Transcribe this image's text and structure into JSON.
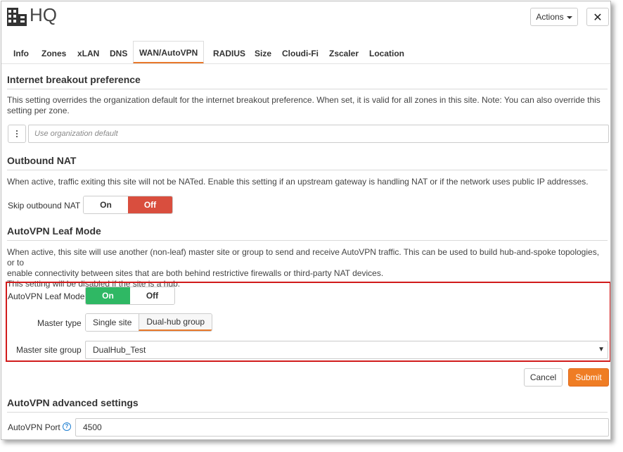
{
  "header": {
    "title": "HQ",
    "actions_label": "Actions",
    "close_label": "✕"
  },
  "tabs": [
    {
      "label": "Info"
    },
    {
      "label": "Zones"
    },
    {
      "label": "xLAN"
    },
    {
      "label": "DNS"
    },
    {
      "label": "WAN/AutoVPN",
      "active": true
    },
    {
      "label": "RADIUS"
    },
    {
      "label": "Size"
    },
    {
      "label": "Cloudi-Fi"
    },
    {
      "label": "Zscaler"
    },
    {
      "label": "Location"
    }
  ],
  "breakout": {
    "title": "Internet breakout preference",
    "description": "This setting overrides the organization default for the internet breakout preference. When set, it is valid for all zones in this site. Note: You can also override this setting per zone.",
    "description_line1": "This setting overrides the organization default for the internet breakout preference. When set, it is valid for all zones in this site. Note: You can also override this",
    "description_line2": "setting per zone.",
    "placeholder": "Use organization default"
  },
  "nat": {
    "title": "Outbound NAT",
    "description": "When active, traffic exiting this site will not be NATed. Enable this setting if an upstream gateway is handling NAT or if the network uses public IP addresses.",
    "skip_label": "Skip outbound NAT",
    "on_label": "On",
    "off_label": "Off",
    "state": "Off"
  },
  "leaf": {
    "title": "AutoVPN Leaf Mode",
    "description_line1": "When active, this site will use another (non-leaf) master site or group to send and receive AutoVPN traffic. This can be used to build hub-and-spoke topologies, or to",
    "description_line2": "enable connectivity between sites that are both behind restrictive firewalls or third-party NAT devices.",
    "description_line3": "This setting will be disabled if the site is a hub.",
    "mode_label": "AutoVPN Leaf Mode",
    "on_label": "On",
    "off_label": "Off",
    "state": "On",
    "master_type_label": "Master type",
    "master_type_options": [
      "Single site",
      "Dual-hub group"
    ],
    "master_type_selected": "Dual-hub group",
    "master_group_label": "Master site group",
    "master_group_value": "DualHub_Test"
  },
  "form": {
    "cancel_label": "Cancel",
    "submit_label": "Submit"
  },
  "advanced": {
    "title": "AutoVPN advanced settings",
    "port_label": "AutoVPN Port",
    "port_value": "4500"
  },
  "colors": {
    "accent": "#ef7d24",
    "off_active": "#d94e3e",
    "on_active": "#2fb864",
    "highlight": "#d11b1b"
  },
  "icons": {
    "site": "building-icon",
    "menu": "kebab-icon",
    "help": "help-icon"
  }
}
